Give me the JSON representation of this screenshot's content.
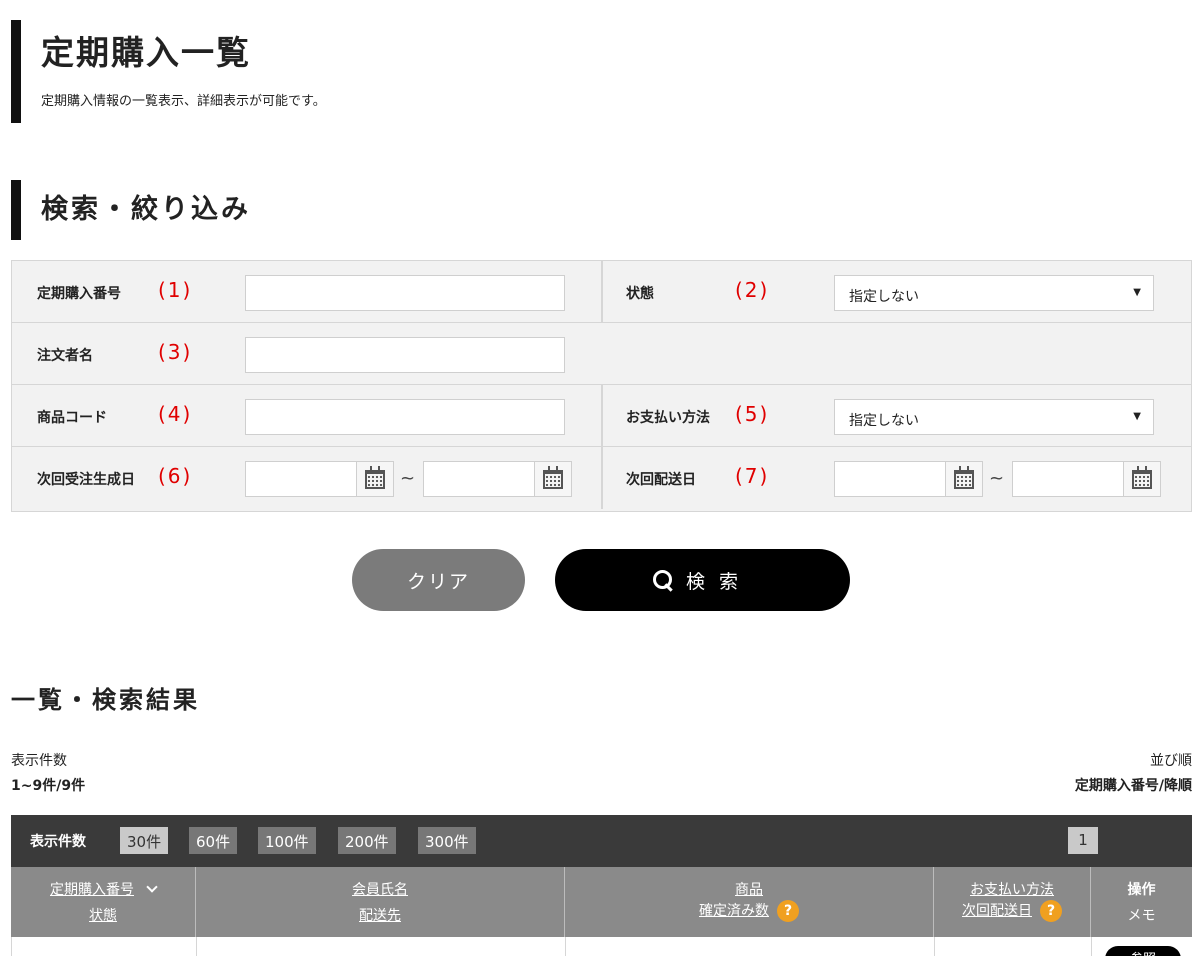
{
  "page": {
    "title": "定期購入一覧",
    "description": "定期購入情報の一覧表示、詳細表示が可能です。"
  },
  "search": {
    "section_title": "検索・絞り込み",
    "fields": {
      "subscription_number": {
        "label": "定期購入番号",
        "marker": "(1)",
        "value": ""
      },
      "status": {
        "label": "状態",
        "marker": "(2)",
        "selected": "指定しない"
      },
      "orderer_name": {
        "label": "注文者名",
        "marker": "(3)",
        "value": ""
      },
      "product_code": {
        "label": "商品コード",
        "marker": "(4)",
        "value": ""
      },
      "payment_method": {
        "label": "お支払い方法",
        "marker": "(5)",
        "selected": "指定しない"
      },
      "next_order_date": {
        "label": "次回受注生成日",
        "marker": "(6)",
        "from": "",
        "to": ""
      },
      "next_delivery_date": {
        "label": "次回配送日",
        "marker": "(7)",
        "from": "",
        "to": ""
      }
    },
    "range_separator": "~",
    "clear_label": "クリア",
    "search_label": "検索"
  },
  "results": {
    "title": "一覧・検索結果",
    "count_label": "表示件数",
    "count_value": "1~9件/9件",
    "sort_label": "並び順",
    "sort_value": "定期購入番号/降順",
    "toolbar": {
      "label": "表示件数",
      "page_sizes": [
        "30件",
        "60件",
        "100件",
        "200件",
        "300件"
      ],
      "active_page_size": "30件",
      "current_page": "1"
    },
    "columns": {
      "col1": {
        "line1": "定期購入番号",
        "line2": "状態"
      },
      "col2": {
        "line1": "会員氏名",
        "line2": "配送先"
      },
      "col3": {
        "line1": "商品",
        "line2": "確定済み数"
      },
      "col4": {
        "line1": "お支払い方法",
        "line2": "次回配送日"
      },
      "col5": {
        "line1": "操作",
        "line2": "メモ"
      }
    },
    "help_icon": "?",
    "row_button_label": "参照"
  },
  "icons": {
    "calendar": "calendar-icon",
    "search": "search-icon",
    "help": "question-icon",
    "sort": "chevron-down-icon",
    "select": "caret-down-icon"
  },
  "colors": {
    "accent_bar": "#111111",
    "required_marker": "#e00000",
    "help_badge": "#f0a020",
    "toolbar": "#3a3a3a",
    "table_header": "#8a8a8a"
  }
}
